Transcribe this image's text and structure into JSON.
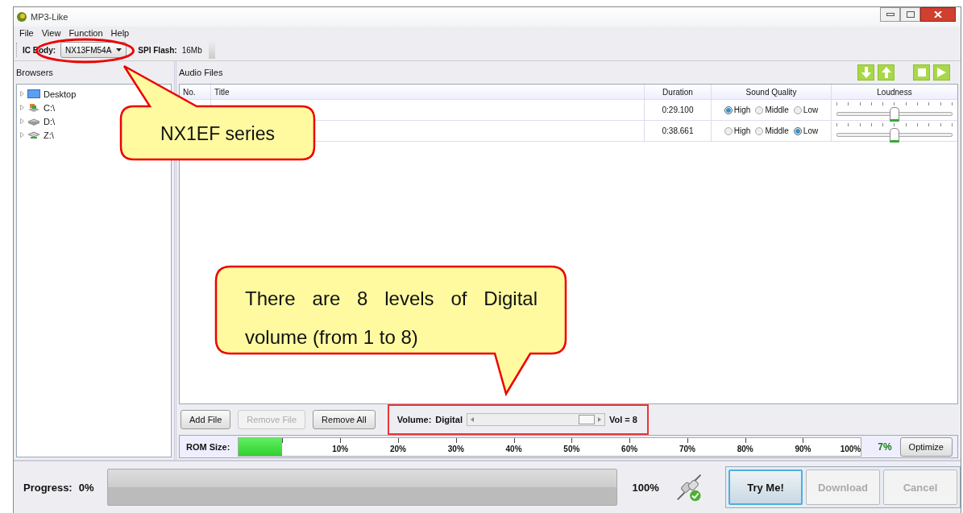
{
  "window": {
    "title": "MP3-Like"
  },
  "menu": [
    "File",
    "View",
    "Function",
    "Help"
  ],
  "toolbar": {
    "ic_body_label": "IC Body:",
    "ic_body_value": "NX13FM54A",
    "spi_label": "SPI Flash:",
    "spi_value": "16Mb"
  },
  "browser": {
    "title": "Browsers",
    "items": [
      {
        "label": "Desktop",
        "kind": "desktop"
      },
      {
        "label": "C:\\",
        "kind": "system"
      },
      {
        "label": "D:\\",
        "kind": "drive"
      },
      {
        "label": "Z:\\",
        "kind": "network"
      }
    ]
  },
  "audio": {
    "title": "Audio Files",
    "columns": [
      "No.",
      "Title",
      "Duration",
      "Sound Quality",
      "Loudness"
    ],
    "rows": [
      {
        "duration": "0:29.100",
        "quality": [
          {
            "label": "High",
            "selected": true
          },
          {
            "label": "Middle",
            "selected": false
          },
          {
            "label": "Low",
            "selected": false
          }
        ],
        "level": 0.5
      },
      {
        "duration": "0:38.661",
        "quality": [
          {
            "label": "High",
            "selected": false
          },
          {
            "label": "Middle",
            "selected": false
          },
          {
            "label": "Low",
            "selected": true
          }
        ],
        "level": 0.5
      }
    ]
  },
  "buttons": [
    {
      "label": "Add File",
      "disabled": false
    },
    {
      "label": "Remove File",
      "disabled": true
    },
    {
      "label": "Remove All",
      "disabled": false
    }
  ],
  "volume": {
    "label": "Volume:",
    "mode": "Digital",
    "level": 1,
    "reading": "Vol = 8"
  },
  "rom": {
    "label": "ROM Size:",
    "level": 0.07,
    "ticks": [
      "10%",
      "20%",
      "30%",
      "40%",
      "50%",
      "60%",
      "70%",
      "80%",
      "90%",
      "100%"
    ],
    "reading": "7%",
    "button": "Optimize"
  },
  "progress": {
    "label": "Progress:",
    "value": "0%",
    "level": 0,
    "end": "100%"
  },
  "actions": [
    {
      "label": "Try Me!",
      "disabled": false
    },
    {
      "label": "Download",
      "disabled": true
    },
    {
      "label": "Cancel",
      "disabled": true
    }
  ],
  "callouts": [
    {
      "text": "NX1EF series"
    },
    {
      "text": "There are 8 levels of Digital volume (from 1 to 8)"
    }
  ]
}
